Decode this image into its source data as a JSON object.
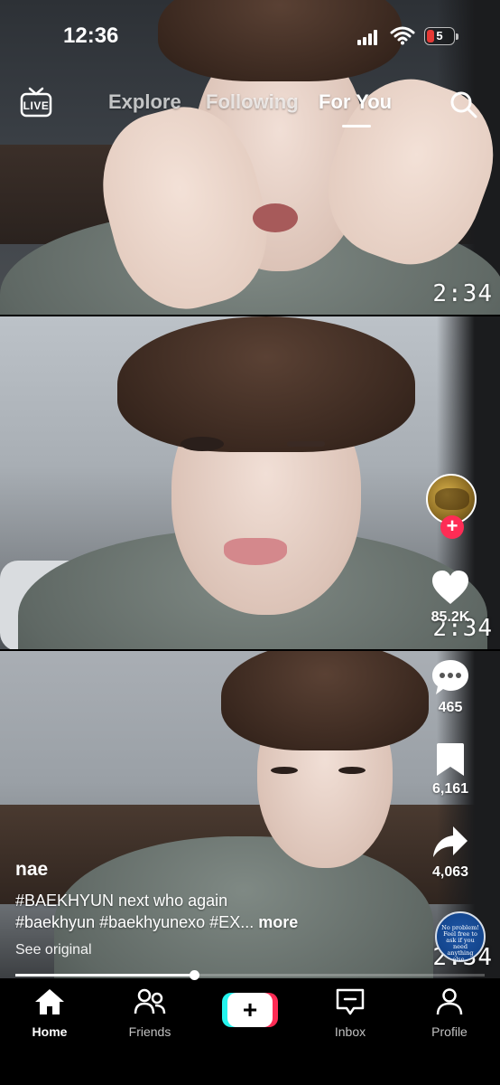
{
  "status_bar": {
    "time": "12:36",
    "battery": "5",
    "icons": [
      "cellular-signal-icon",
      "wifi-icon",
      "battery-icon"
    ]
  },
  "top_nav": {
    "live_label": "LIVE",
    "tabs": [
      {
        "label": "Explore",
        "active": false
      },
      {
        "label": "Following",
        "active": false
      },
      {
        "label": "For You",
        "active": true
      }
    ],
    "search_icon": "search-icon"
  },
  "video": {
    "timestamps": [
      "2:34",
      "2:34",
      "2:34"
    ]
  },
  "right_rail": {
    "avatar_icon": "creator-avatar",
    "follow_symbol": "+",
    "like_count": "85.2K",
    "comment_count": "465",
    "bookmark_count": "6,161",
    "share_count": "4,063",
    "sound_disc_text": "No problem! Feel free to ask if you need anything else.."
  },
  "post": {
    "username": "nae",
    "description_line1": "#BAEKHYUN next who again",
    "description_line2": "#baekhyun #baekhyunexo #EX...",
    "more_label": "more",
    "see_original": "See original",
    "progress_percent": 38
  },
  "bottom_nav": {
    "items": [
      {
        "label": "Home",
        "icon": "home-icon",
        "active": true
      },
      {
        "label": "Friends",
        "icon": "friends-icon",
        "active": false
      },
      {
        "label": "",
        "icon": "create-plus-icon",
        "active": false
      },
      {
        "label": "Inbox",
        "icon": "inbox-icon",
        "active": false
      },
      {
        "label": "Profile",
        "icon": "profile-icon",
        "active": false
      }
    ],
    "create_symbol": "+"
  },
  "colors": {
    "accent_red": "#fe2c55",
    "accent_cyan": "#25f4ee",
    "battery_low": "#e53935"
  }
}
